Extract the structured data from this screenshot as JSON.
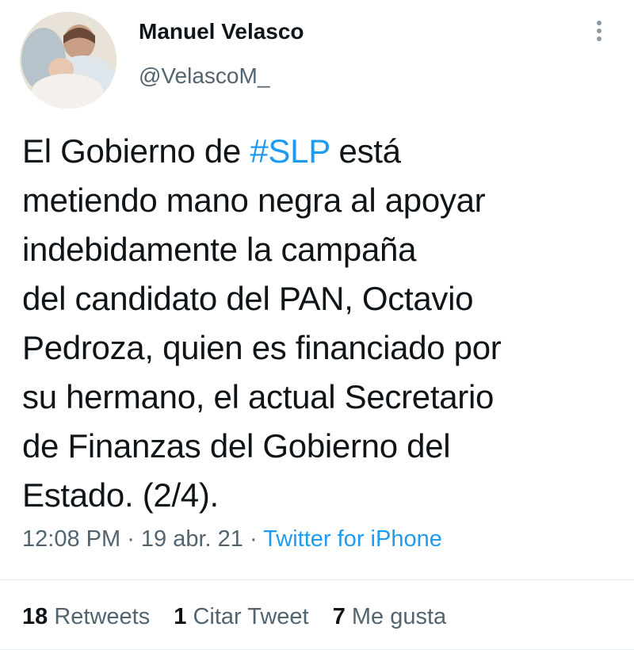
{
  "author": {
    "display_name": "Manuel Velasco",
    "handle": "@VelascoM_",
    "avatar_icon": "profile-photo"
  },
  "tweet": {
    "lines": [
      {
        "before": "El Gobierno de ",
        "hashtag": "#SLP",
        "after": " está"
      },
      {
        "text": "metiendo mano negra al apoyar"
      },
      {
        "text": "indebidamente la campaña"
      },
      {
        "text": "del candidato del PAN, Octavio"
      },
      {
        "text": "Pedroza, quien es financiado por"
      },
      {
        "text": "su hermano, el actual Secretario"
      },
      {
        "text": "de Finanzas del Gobierno del"
      },
      {
        "text": "Estado. (2/4)."
      }
    ]
  },
  "meta": {
    "time": "12:08 PM",
    "date": "19 abr. 21",
    "separator": " · ",
    "source": "Twitter for iPhone"
  },
  "stats": {
    "retweets": {
      "count": "18",
      "label": " Retweets"
    },
    "quotes": {
      "count": "1",
      "label": " Citar Tweet"
    },
    "likes": {
      "count": "7",
      "label": " Me gusta"
    }
  },
  "colors": {
    "link": "#1d9bf0",
    "text": "#0f1419",
    "secondary": "#536471"
  }
}
